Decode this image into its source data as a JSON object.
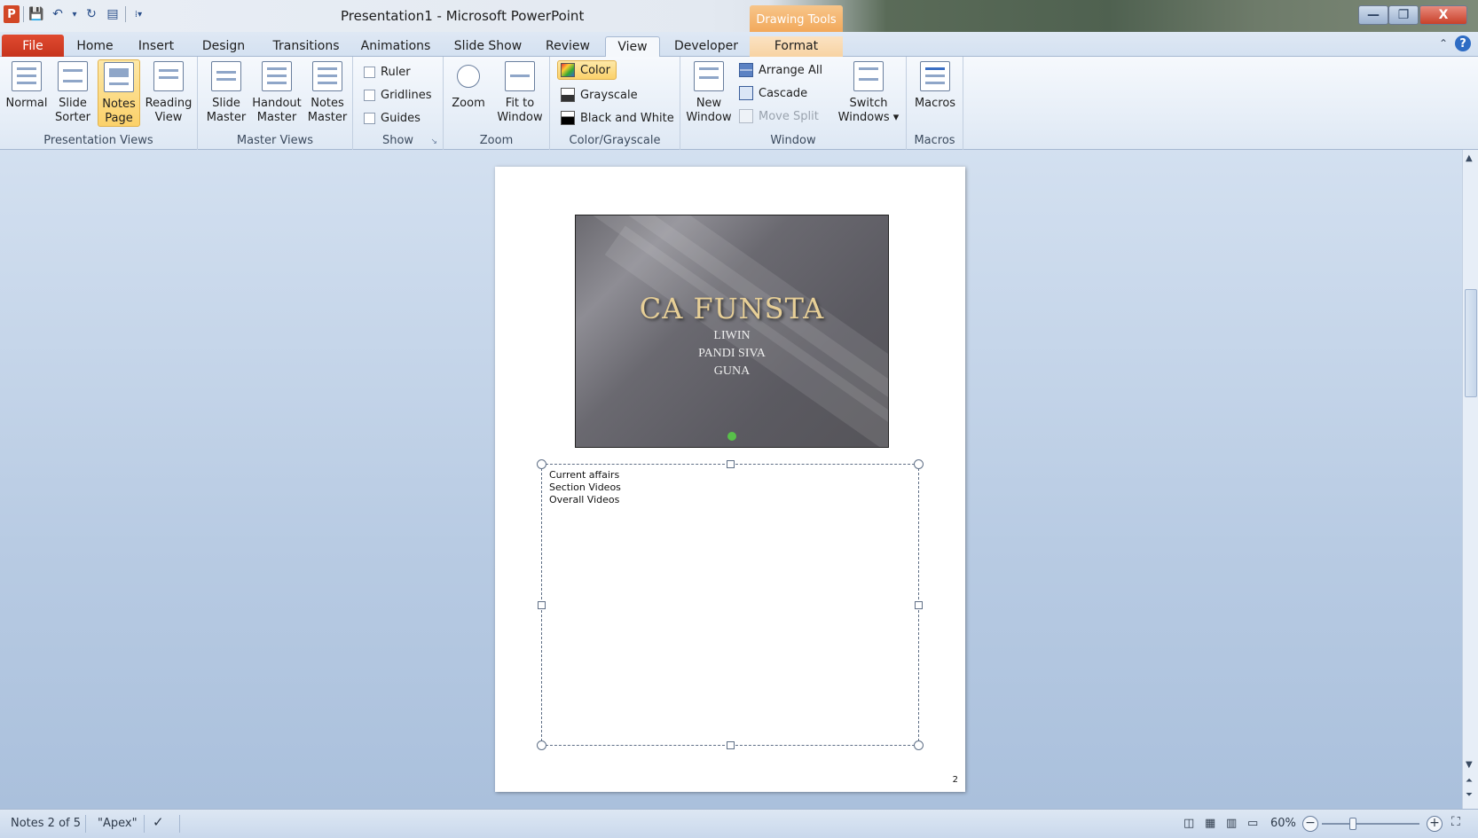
{
  "window": {
    "title": "Presentation1  -  Microsoft PowerPoint",
    "contextual_tab_group": "Drawing Tools",
    "logo_letter": "P",
    "min_symbol": "—",
    "max_symbol": "❐",
    "close_symbol": "X"
  },
  "qat": {
    "save_icon": "💾",
    "undo_icon": "↶",
    "dropdown": "▾",
    "redo_icon": "↻",
    "slideshow_icon": "▤",
    "customize": "⁞▾"
  },
  "tabs": {
    "file": "File",
    "home": "Home",
    "insert": "Insert",
    "design": "Design",
    "transitions": "Transitions",
    "animations": "Animations",
    "slide_show": "Slide Show",
    "review": "Review",
    "view": "View",
    "developer": "Developer",
    "format": "Format",
    "minimize_ribbon": "⌃",
    "help": "?"
  },
  "ribbon": {
    "presentation_views": {
      "label": "Presentation Views",
      "normal": [
        "Normal",
        ""
      ],
      "slide_sorter": [
        "Slide",
        "Sorter"
      ],
      "notes_page": [
        "Notes",
        "Page"
      ],
      "reading_view": [
        "Reading",
        "View"
      ]
    },
    "master_views": {
      "label": "Master Views",
      "slide_master": [
        "Slide",
        "Master"
      ],
      "handout_master": [
        "Handout",
        "Master"
      ],
      "notes_master": [
        "Notes",
        "Master"
      ]
    },
    "show": {
      "label": "Show",
      "ruler": "Ruler",
      "gridlines": "Gridlines",
      "guides": "Guides",
      "launcher": "↘"
    },
    "zoom": {
      "label": "Zoom",
      "zoom": [
        "Zoom",
        ""
      ],
      "fit_to_window": [
        "Fit to",
        "Window"
      ]
    },
    "color_grayscale": {
      "label": "Color/Grayscale",
      "color": "Color",
      "grayscale": "Grayscale",
      "black_and_white": "Black and White"
    },
    "window": {
      "label": "Window",
      "new_window": [
        "New",
        "Window"
      ],
      "arrange_all": "Arrange All",
      "cascade": "Cascade",
      "move_split": "Move Split",
      "switch_windows": [
        "Switch",
        "Windows ▾"
      ]
    },
    "macros": {
      "label": "Macros",
      "macros": "Macros"
    }
  },
  "slide": {
    "title": "CA FUNSTA",
    "subtitle_lines": [
      "LIWIN",
      "PANDI SIVA",
      "GUNA"
    ]
  },
  "notes": {
    "lines": [
      "Current affairs",
      "Section Videos",
      "Overall Videos"
    ],
    "page_number": "2"
  },
  "statusbar": {
    "slide_info": "Notes 2 of 5",
    "theme": "\"Apex\"",
    "zoom_level": "60%",
    "zoom_minus": "−",
    "zoom_plus": "+"
  },
  "colors": {
    "file_tab": "#c6341d",
    "active_button": "#fbd16a",
    "workspace": "#b8cbe3",
    "slide_title": "#e7cf97"
  }
}
